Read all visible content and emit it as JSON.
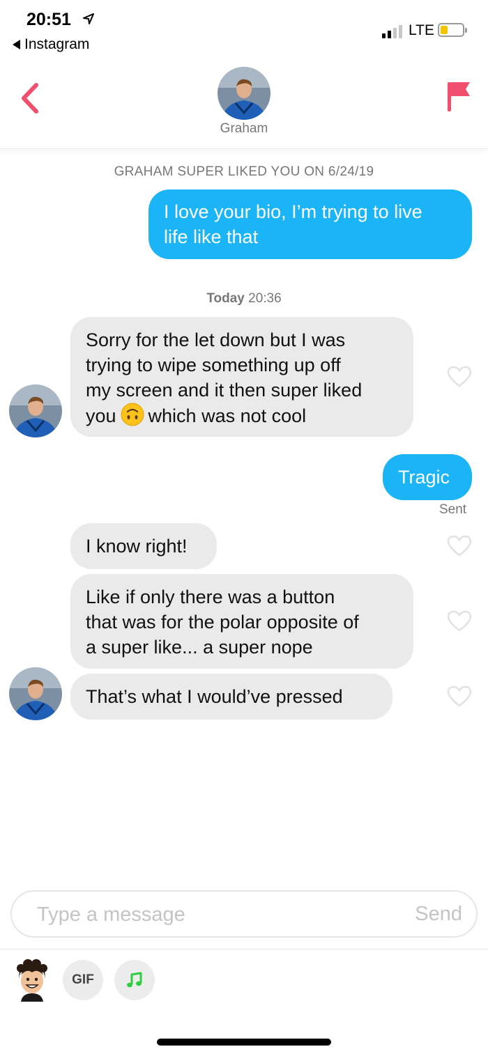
{
  "status_bar": {
    "time": "20:51",
    "back_app": "Instagram",
    "network": "LTE",
    "battery_level": 0.3
  },
  "header": {
    "name": "Graham",
    "accent_color": "#f0506e"
  },
  "system_note": "GRAHAM SUPER LIKED YOU ON 6/24/19",
  "today_note": {
    "day": "Today",
    "time": "20:36"
  },
  "messages": {
    "m1": {
      "lines": [
        "I love your bio, I’m trying to live",
        "life like that"
      ]
    },
    "m2": {
      "lines": [
        "Sorry for the let down but I was",
        "trying to wipe something up off",
        "my screen and it then super liked"
      ],
      "last_before": "you",
      "emoji": "upside-down-face",
      "last_after": "which was not cool"
    },
    "m3": {
      "text": "Tragic",
      "status": "Sent"
    },
    "m4": {
      "text": "I know right!"
    },
    "m5": {
      "lines": [
        "Like if only there was a button",
        "that was for the polar opposite of",
        "a super like... a super nope"
      ]
    },
    "m6": {
      "text": "That’s what I would’ve pressed"
    }
  },
  "composer": {
    "placeholder": "Type a message",
    "send_label": "Send",
    "gif_label": "GIF"
  },
  "colors": {
    "outgoing_bubble": "#1ab4f7",
    "incoming_bubble": "#eaeaea",
    "music_icon": "#2ecc40"
  }
}
